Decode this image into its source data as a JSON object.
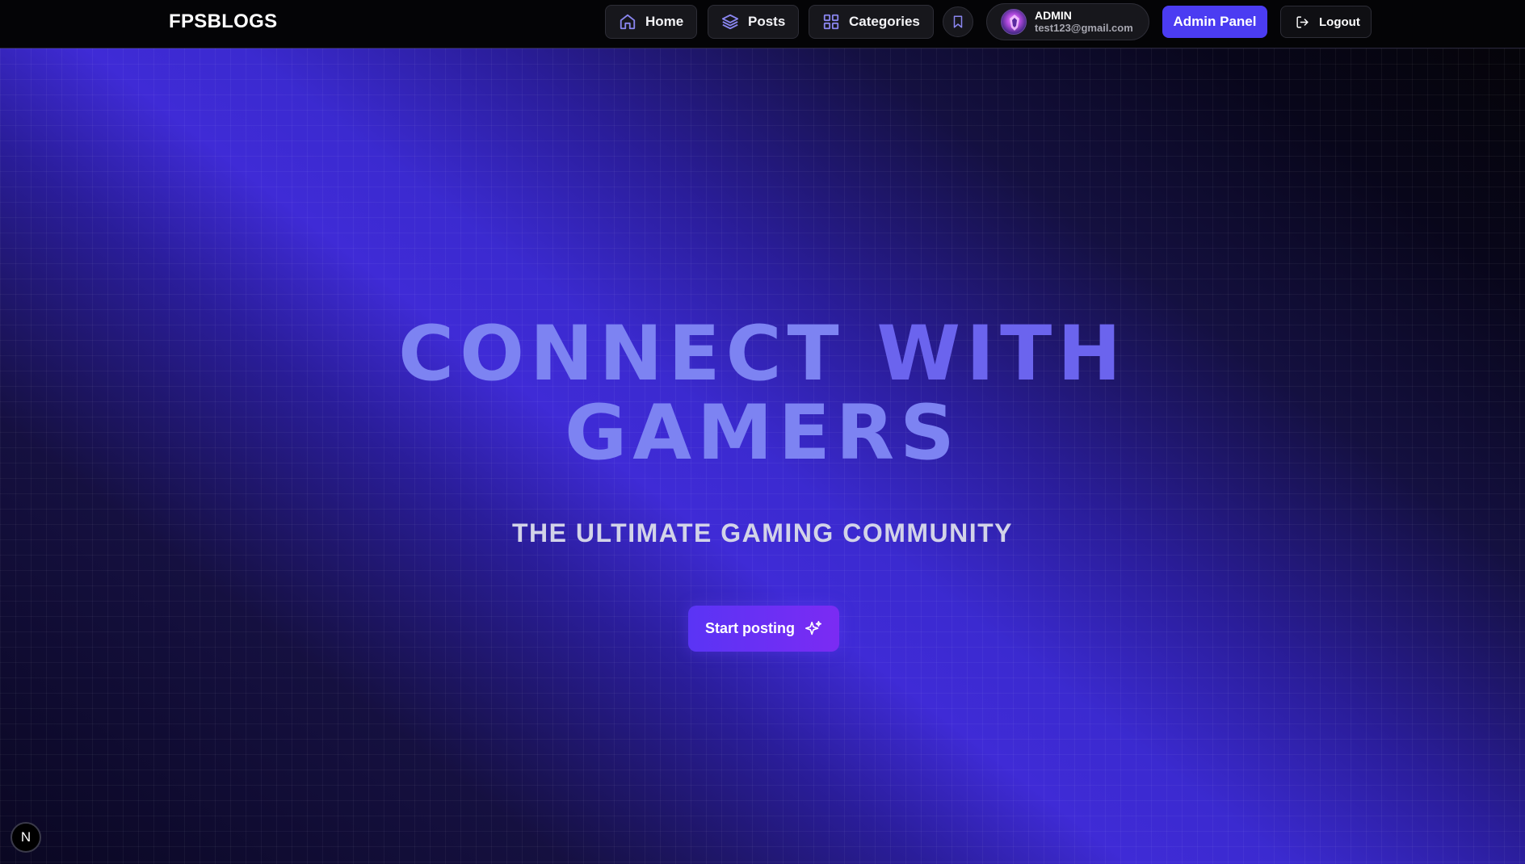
{
  "navbar": {
    "logo": "FPSBLOGS",
    "items": [
      {
        "label": "Home",
        "icon": "home-icon"
      },
      {
        "label": "Posts",
        "icon": "layers-icon"
      },
      {
        "label": "Categories",
        "icon": "grid-icon"
      }
    ],
    "bookmark_icon": "bookmark-icon",
    "user": {
      "name": "ADMIN",
      "email": "test123@gmail.com"
    },
    "admin_label": "Admin Panel",
    "logout_label": "Logout"
  },
  "hero": {
    "headline_line1_a": "CONNECT",
    "headline_line1_b": "WITH",
    "headline_line2": "GAMERS",
    "subheadline": "THE ULTIMATE GAMING COMMUNITY",
    "cta_label": "Start posting"
  },
  "badge": {
    "label": "N"
  },
  "colors": {
    "accent": "#4b3cf2",
    "headline": "#7d83f2",
    "background": "#050409"
  }
}
